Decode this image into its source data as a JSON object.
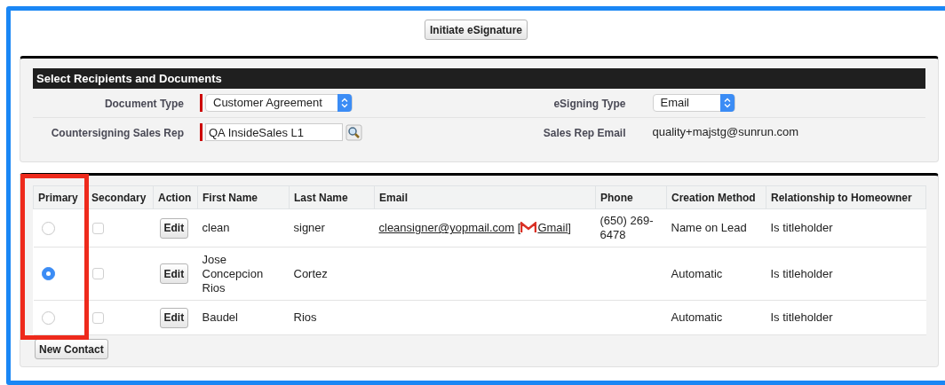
{
  "top_button": "Initiate eSignature",
  "section": {
    "title": "Select Recipients and Documents",
    "fields": [
      {
        "kind": "select",
        "label": "Document Type",
        "value": "Customer Agreement",
        "required": true
      },
      {
        "kind": "select",
        "label": "eSigning Type",
        "value": "Email",
        "required": false
      },
      {
        "kind": "lookup",
        "label": "Countersigning Sales Rep",
        "value": "QA InsideSales L1",
        "required": true
      },
      {
        "kind": "text",
        "label": "Sales Rep Email",
        "value": "quality+majstg@sunrun.com",
        "required": false
      }
    ]
  },
  "table": {
    "columns": [
      "Primary",
      "Secondary",
      "Action",
      "First Name",
      "Last Name",
      "Email",
      "Phone",
      "Creation Method",
      "Relationship to Homeowner"
    ],
    "rows": [
      {
        "selected": false,
        "checked": false,
        "action": "Edit",
        "first_name": "clean",
        "last_name": "signer",
        "email": {
          "address": "cleansigner@yopmail.com",
          "open": "[",
          "link": "Gmail",
          "close": "]"
        },
        "phone": "(650) 269-6478",
        "creation_method": "Name on Lead",
        "relationship": "Is titleholder"
      },
      {
        "selected": true,
        "checked": false,
        "action": "Edit",
        "first_name": "Jose Concepcion Rios",
        "last_name": "Cortez",
        "creation_method": "Automatic",
        "relationship": "Is titleholder"
      },
      {
        "selected": false,
        "checked": false,
        "action": "Edit",
        "first_name": "Baudel",
        "last_name": "Rios",
        "creation_method": "Automatic",
        "relationship": "Is titleholder"
      }
    ]
  },
  "bottom_button": "New Contact"
}
